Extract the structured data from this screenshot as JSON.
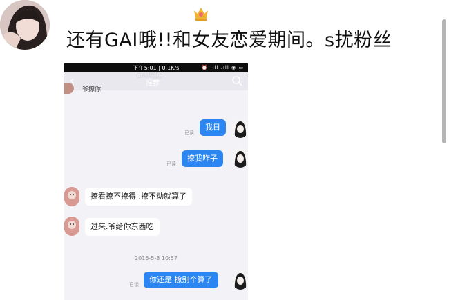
{
  "post": {
    "text": "还有GAI哦!!和女友恋爱期间。s扰粉丝"
  },
  "status_bar": {
    "time": "下午5:01 | 0.1K/s",
    "icons": "⏰ .ıll .ıll ◉ ▭"
  },
  "nav": {
    "back": "‹",
    "ghost_title": "GAI周延",
    "title": "推荐"
  },
  "old_message": "爷撩你",
  "messages": [
    {
      "side": "right",
      "text": "我日",
      "read": "已读"
    },
    {
      "side": "right",
      "text": "撩我咋子",
      "read": "已读"
    },
    {
      "side": "left",
      "text": "撩看撩不撩得 .撩不动就算了"
    },
    {
      "side": "left",
      "text": "过来.爷给你东西吃"
    },
    {
      "side": "right",
      "text": "你还是 撩别个算了",
      "read": "已读"
    }
  ],
  "timestamp": "2016-5-8 10:57"
}
